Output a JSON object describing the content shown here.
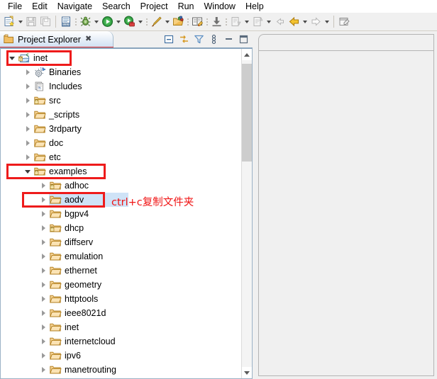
{
  "menubar": {
    "items": [
      {
        "label": "File"
      },
      {
        "label": "Edit"
      },
      {
        "label": "Navigate"
      },
      {
        "label": "Search"
      },
      {
        "label": "Project"
      },
      {
        "label": "Run"
      },
      {
        "label": "Window"
      },
      {
        "label": "Help"
      }
    ]
  },
  "toolbar": {
    "items": [
      {
        "name": "new-wizard-icon",
        "type": "icon"
      },
      {
        "name": "new-wizard-dropdown-arrow",
        "type": "arrow"
      },
      {
        "name": "save-icon",
        "type": "icon"
      },
      {
        "name": "save-all-icon",
        "type": "icon"
      },
      {
        "name": "separator-line",
        "type": "line"
      },
      {
        "name": "build-icon",
        "type": "icon"
      },
      {
        "name": "separator-dots",
        "type": "dots"
      },
      {
        "name": "debug-icon",
        "type": "icon"
      },
      {
        "name": "debug-dropdown-arrow",
        "type": "arrow"
      },
      {
        "name": "run-icon",
        "type": "icon"
      },
      {
        "name": "run-dropdown-arrow",
        "type": "arrow"
      },
      {
        "name": "profile-icon",
        "type": "icon"
      },
      {
        "name": "profile-dropdown-arrow",
        "type": "arrow"
      },
      {
        "name": "separator-dots",
        "type": "dots"
      },
      {
        "name": "external-tools-icon",
        "type": "icon"
      },
      {
        "name": "external-tools-dropdown-arrow",
        "type": "arrow"
      },
      {
        "name": "open-type-icon",
        "type": "icon"
      },
      {
        "name": "separator-dots",
        "type": "dots"
      },
      {
        "name": "open-task-icon",
        "type": "icon"
      },
      {
        "name": "separator-dots",
        "type": "dots"
      },
      {
        "name": "import-icon",
        "type": "icon"
      },
      {
        "name": "separator-dots",
        "type": "dots"
      },
      {
        "name": "next-annotation-icon",
        "type": "icon"
      },
      {
        "name": "next-annotation-dropdown-arrow",
        "type": "arrow"
      },
      {
        "name": "previous-annotation-icon",
        "type": "icon"
      },
      {
        "name": "previous-annotation-dropdown-arrow",
        "type": "arrow"
      },
      {
        "name": "back-history-icon",
        "type": "icon"
      },
      {
        "name": "back-navigation-icon",
        "type": "icon"
      },
      {
        "name": "back-dropdown-arrow",
        "type": "arrow"
      },
      {
        "name": "forward-navigation-icon",
        "type": "icon"
      },
      {
        "name": "forward-dropdown-arrow",
        "type": "arrow"
      },
      {
        "name": "separator-line",
        "type": "line"
      },
      {
        "name": "new-editor-icon",
        "type": "icon"
      }
    ]
  },
  "view": {
    "tab_title": "Project Explorer",
    "tab_close_glyph": "✖",
    "toolbar_icons": [
      {
        "name": "collapse-all-icon"
      },
      {
        "name": "link-with-editor-icon"
      },
      {
        "name": "view-filter-icon"
      },
      {
        "name": "view-menu-icon"
      },
      {
        "name": "minimize-icon"
      },
      {
        "name": "maximize-icon"
      }
    ]
  },
  "tree": {
    "items": [
      {
        "label": "inet",
        "depth": 0,
        "state": "expanded",
        "icon": "cpp-project-icon",
        "selected": false
      },
      {
        "label": "Binaries",
        "depth": 1,
        "state": "collapsed",
        "icon": "binaries-icon",
        "selected": false
      },
      {
        "label": "Includes",
        "depth": 1,
        "state": "collapsed",
        "icon": "includes-icon",
        "selected": false
      },
      {
        "label": "src",
        "depth": 1,
        "state": "collapsed",
        "icon": "source-folder-icon",
        "selected": false
      },
      {
        "label": "_scripts",
        "depth": 1,
        "state": "collapsed",
        "icon": "folder-icon",
        "selected": false
      },
      {
        "label": "3rdparty",
        "depth": 1,
        "state": "collapsed",
        "icon": "folder-icon",
        "selected": false
      },
      {
        "label": "doc",
        "depth": 1,
        "state": "collapsed",
        "icon": "folder-icon",
        "selected": false
      },
      {
        "label": "etc",
        "depth": 1,
        "state": "collapsed",
        "icon": "folder-icon",
        "selected": false
      },
      {
        "label": "examples",
        "depth": 1,
        "state": "expanded",
        "icon": "source-folder-icon",
        "selected": false
      },
      {
        "label": "adhoc",
        "depth": 2,
        "state": "collapsed",
        "icon": "source-folder-icon",
        "selected": false
      },
      {
        "label": "aodv",
        "depth": 2,
        "state": "collapsed",
        "icon": "folder-icon",
        "selected": true
      },
      {
        "label": "bgpv4",
        "depth": 2,
        "state": "collapsed",
        "icon": "folder-icon",
        "selected": false
      },
      {
        "label": "dhcp",
        "depth": 2,
        "state": "collapsed",
        "icon": "source-folder-icon",
        "selected": false
      },
      {
        "label": "diffserv",
        "depth": 2,
        "state": "collapsed",
        "icon": "folder-icon",
        "selected": false
      },
      {
        "label": "emulation",
        "depth": 2,
        "state": "collapsed",
        "icon": "folder-icon",
        "selected": false
      },
      {
        "label": "ethernet",
        "depth": 2,
        "state": "collapsed",
        "icon": "folder-icon",
        "selected": false
      },
      {
        "label": "geometry",
        "depth": 2,
        "state": "collapsed",
        "icon": "folder-icon",
        "selected": false
      },
      {
        "label": "httptools",
        "depth": 2,
        "state": "collapsed",
        "icon": "folder-icon",
        "selected": false
      },
      {
        "label": "ieee8021d",
        "depth": 2,
        "state": "collapsed",
        "icon": "folder-icon",
        "selected": false
      },
      {
        "label": "inet",
        "depth": 2,
        "state": "collapsed",
        "icon": "folder-icon",
        "selected": false
      },
      {
        "label": "internetcloud",
        "depth": 2,
        "state": "collapsed",
        "icon": "folder-icon",
        "selected": false
      },
      {
        "label": "ipv6",
        "depth": 2,
        "state": "collapsed",
        "icon": "folder-icon",
        "selected": false
      },
      {
        "label": "manetrouting",
        "depth": 2,
        "state": "collapsed",
        "icon": "folder-icon",
        "selected": false
      }
    ]
  },
  "annotations": {
    "color": "#f01414",
    "note_text": "ctrl+c复制文件夹",
    "highlight_boxes": [
      {
        "name": "highlight-box-inet",
        "target": "inet"
      },
      {
        "name": "highlight-box-examples",
        "target": "examples"
      },
      {
        "name": "highlight-box-aodv",
        "target": "aodv"
      }
    ]
  },
  "scrollbar": {
    "up_glyph": "▲",
    "down_glyph": "▼"
  },
  "editor": {
    "content": ""
  }
}
